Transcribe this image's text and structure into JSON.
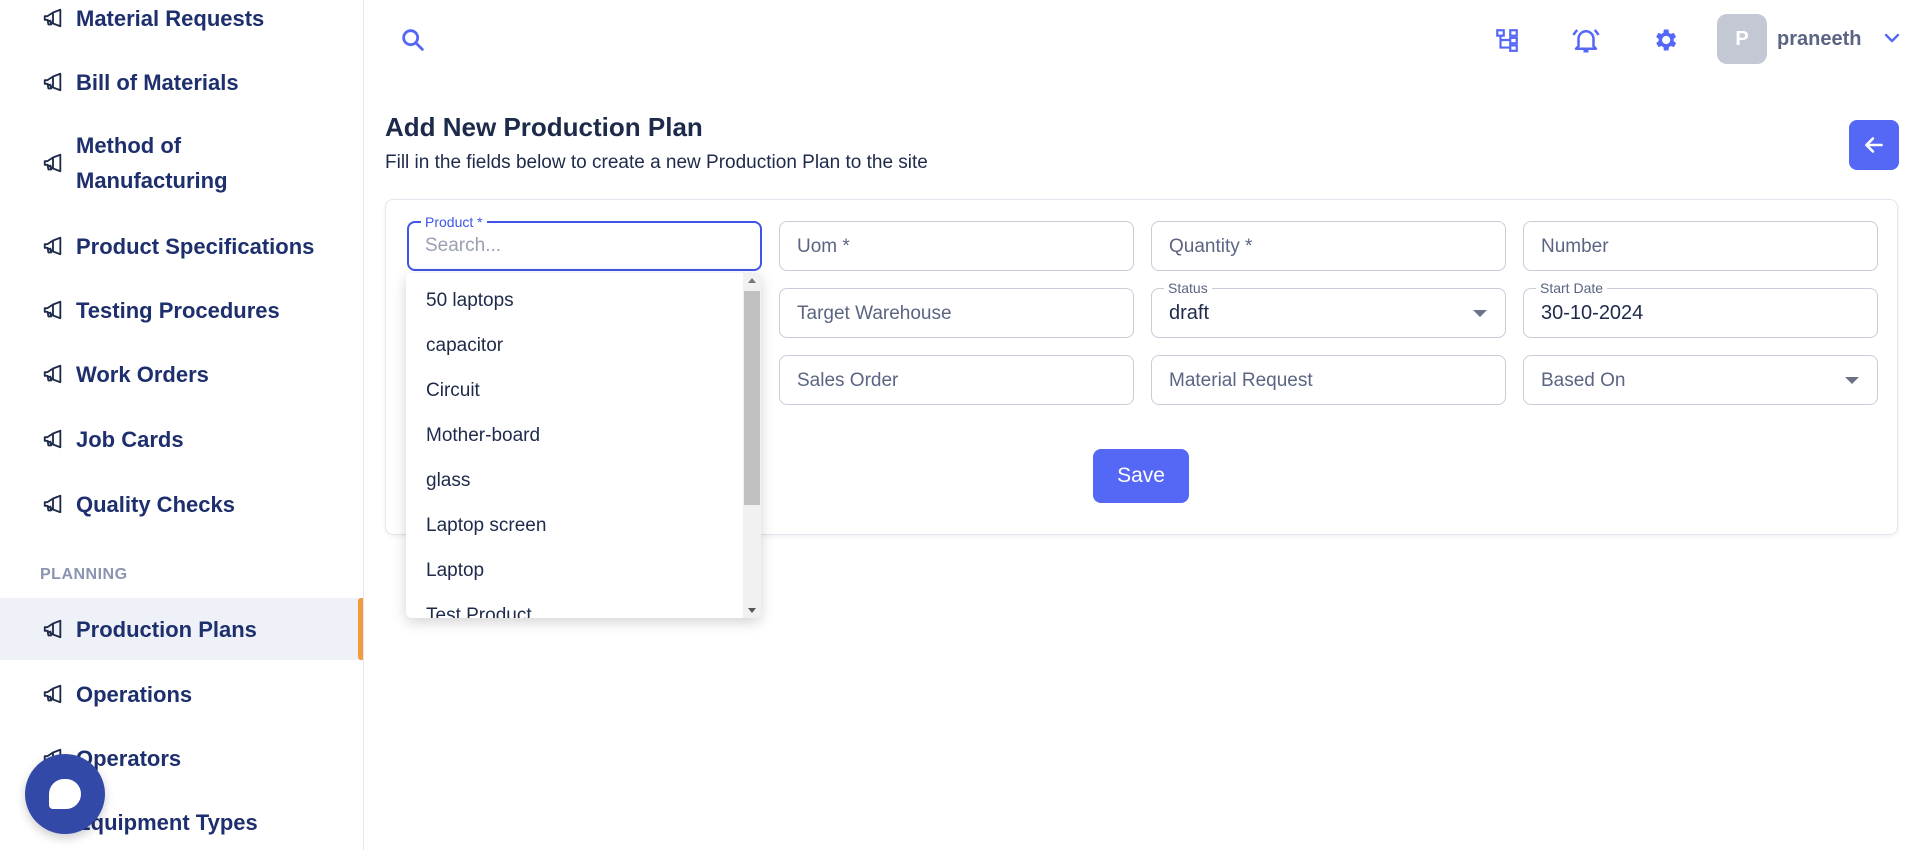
{
  "sidebar": {
    "items": [
      {
        "label": "Material Requests"
      },
      {
        "label": "Bill of Materials"
      },
      {
        "label": "Method of",
        "label2": "Manufacturing"
      },
      {
        "label": "Product Specifications"
      },
      {
        "label": "Testing Procedures"
      },
      {
        "label": "Work Orders"
      },
      {
        "label": "Job Cards"
      },
      {
        "label": "Quality Checks"
      },
      {
        "label": "Production Plans"
      },
      {
        "label": "Operations"
      },
      {
        "label": "Operators"
      },
      {
        "label": "Equipment Types"
      }
    ],
    "section_planning": "PLANNING",
    "active_item": "Production Plans"
  },
  "topbar": {
    "avatar_initial": "P",
    "user_name": "praneeth"
  },
  "page": {
    "title": "Add New Production Plan",
    "subtitle": "Fill in the fields below to create a new Production Plan to the site"
  },
  "form": {
    "product": {
      "label": "Product *",
      "placeholder": "Search..."
    },
    "uom": {
      "placeholder": "Uom *"
    },
    "quantity": {
      "placeholder": "Quantity *"
    },
    "number": {
      "placeholder": "Number"
    },
    "target_warehouse": {
      "placeholder": "Target Warehouse"
    },
    "status": {
      "label": "Status",
      "value": "draft"
    },
    "start_date": {
      "label": "Start Date",
      "value": "30-10-2024"
    },
    "sales_order": {
      "placeholder": "Sales Order"
    },
    "material_request": {
      "placeholder": "Material Request"
    },
    "based_on": {
      "placeholder": "Based On"
    },
    "save_label": "Save"
  },
  "product_dropdown": {
    "options": [
      "50 laptops",
      "capacitor",
      "Circuit",
      "Mother-board",
      "glass",
      "Laptop screen",
      "Laptop",
      "Test Product"
    ]
  },
  "colors": {
    "accent": "#5567f5",
    "active_indicator": "#f39a3c",
    "sidebar_text": "#1e2f6e"
  }
}
